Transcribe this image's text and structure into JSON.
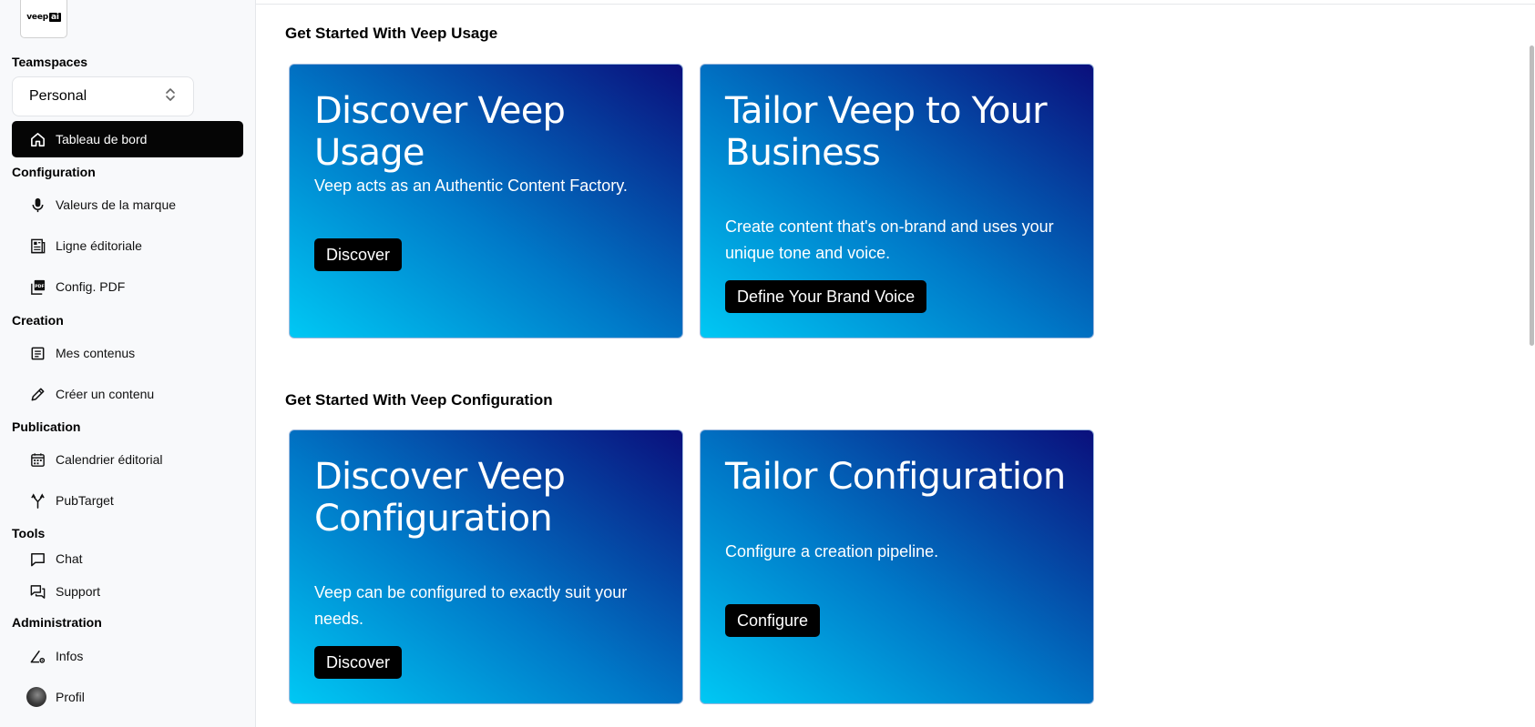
{
  "logo": {
    "text": "veep",
    "badge": "ai"
  },
  "sidebar": {
    "teamspaces_title": "Teamspaces",
    "teamspace_select": "Personal",
    "dashboard_label": "Tableau de bord",
    "configuration_title": "Configuration",
    "configuration_items": [
      "Valeurs de la marque",
      "Ligne éditoriale",
      "Config. PDF"
    ],
    "creation_title": "Creation",
    "creation_items": [
      "Mes contenus",
      "Créer un contenu"
    ],
    "publication_title": "Publication",
    "publication_items": [
      "Calendrier éditorial",
      "PubTarget"
    ],
    "tools_title": "Tools",
    "tools_items": [
      "Chat",
      "Support"
    ],
    "administration_title": "Administration",
    "administration_items": [
      "Infos",
      "Profil"
    ]
  },
  "main": {
    "usage_section_title": "Get Started With Veep Usage",
    "usage_cards": [
      {
        "title": "Discover Veep Usage",
        "text": "Veep acts as an Authentic Content Factory.",
        "button": "Discover"
      },
      {
        "title": "Tailor Veep to Your Business",
        "text": "Create content that's on-brand and uses your unique tone and voice.",
        "button": "Define Your Brand Voice"
      }
    ],
    "config_section_title": "Get Started With Veep Configuration",
    "config_cards": [
      {
        "title": "Discover Veep Configuration",
        "text": "Veep can be configured to exactly suit your needs.",
        "button": "Discover"
      },
      {
        "title": "Tailor Configuration",
        "text": "Configure a creation pipeline.",
        "button": "Configure"
      }
    ]
  },
  "colors": {
    "card_gradient_start": "#00c8f4",
    "card_gradient_mid": "#0079c8",
    "card_gradient_end": "#0a0f7c",
    "active_nav": "#050505"
  },
  "icons": [
    "home-icon",
    "microphone-icon",
    "newspaper-icon",
    "pdf-icon",
    "document-list-icon",
    "pencil-icon",
    "calendar-icon",
    "fork-icon",
    "chat-icon",
    "support-chat-icon",
    "settings-pen-icon"
  ]
}
